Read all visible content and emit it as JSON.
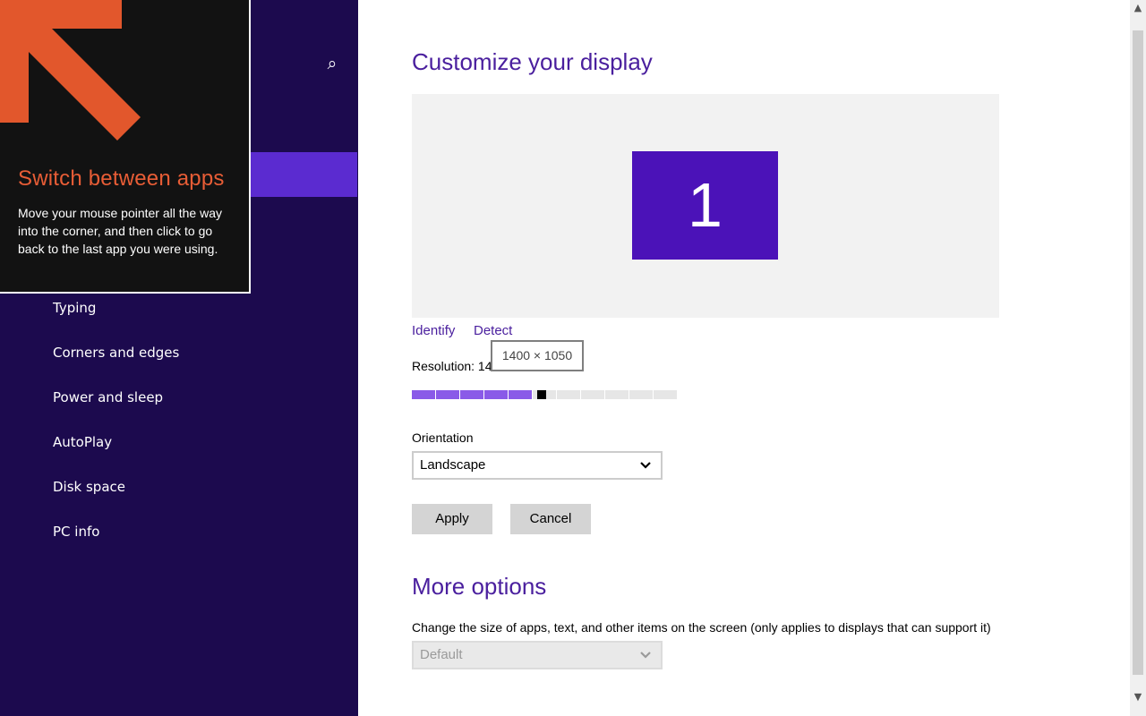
{
  "nav": {
    "search_icon": "search-icon",
    "items": [
      "Typing",
      "Corners and edges",
      "Power and sleep",
      "AutoPlay",
      "Disk space",
      "PC info"
    ]
  },
  "tip": {
    "title": "Switch between apps",
    "body": "Move your mouse pointer all the way into the corner, and then click to go back to the last app you were using.",
    "arrow_color": "#e2572c"
  },
  "main": {
    "title": "Customize your display",
    "monitor_number": "1",
    "identify_link": "Identify",
    "detect_link": "Detect",
    "resolution_label": "Resolution: 14",
    "resolution_tooltip": "1400 × 1050",
    "resolution_slider_fraction": 0.5,
    "orientation_label": "Orientation",
    "orientation_value": "Landscape",
    "apply_button": "Apply",
    "cancel_button": "Cancel",
    "more_options_title": "More options",
    "size_description": "Change the size of apps, text, and other items on the screen (only applies to displays that can support it)",
    "size_value": "Default"
  },
  "colors": {
    "nav_bg": "#1c0a4e",
    "accent": "#4b12b8",
    "heading": "#4a1f9e",
    "slider_fill": "#8a5ae8",
    "slider_empty": "#e6e6e6"
  }
}
